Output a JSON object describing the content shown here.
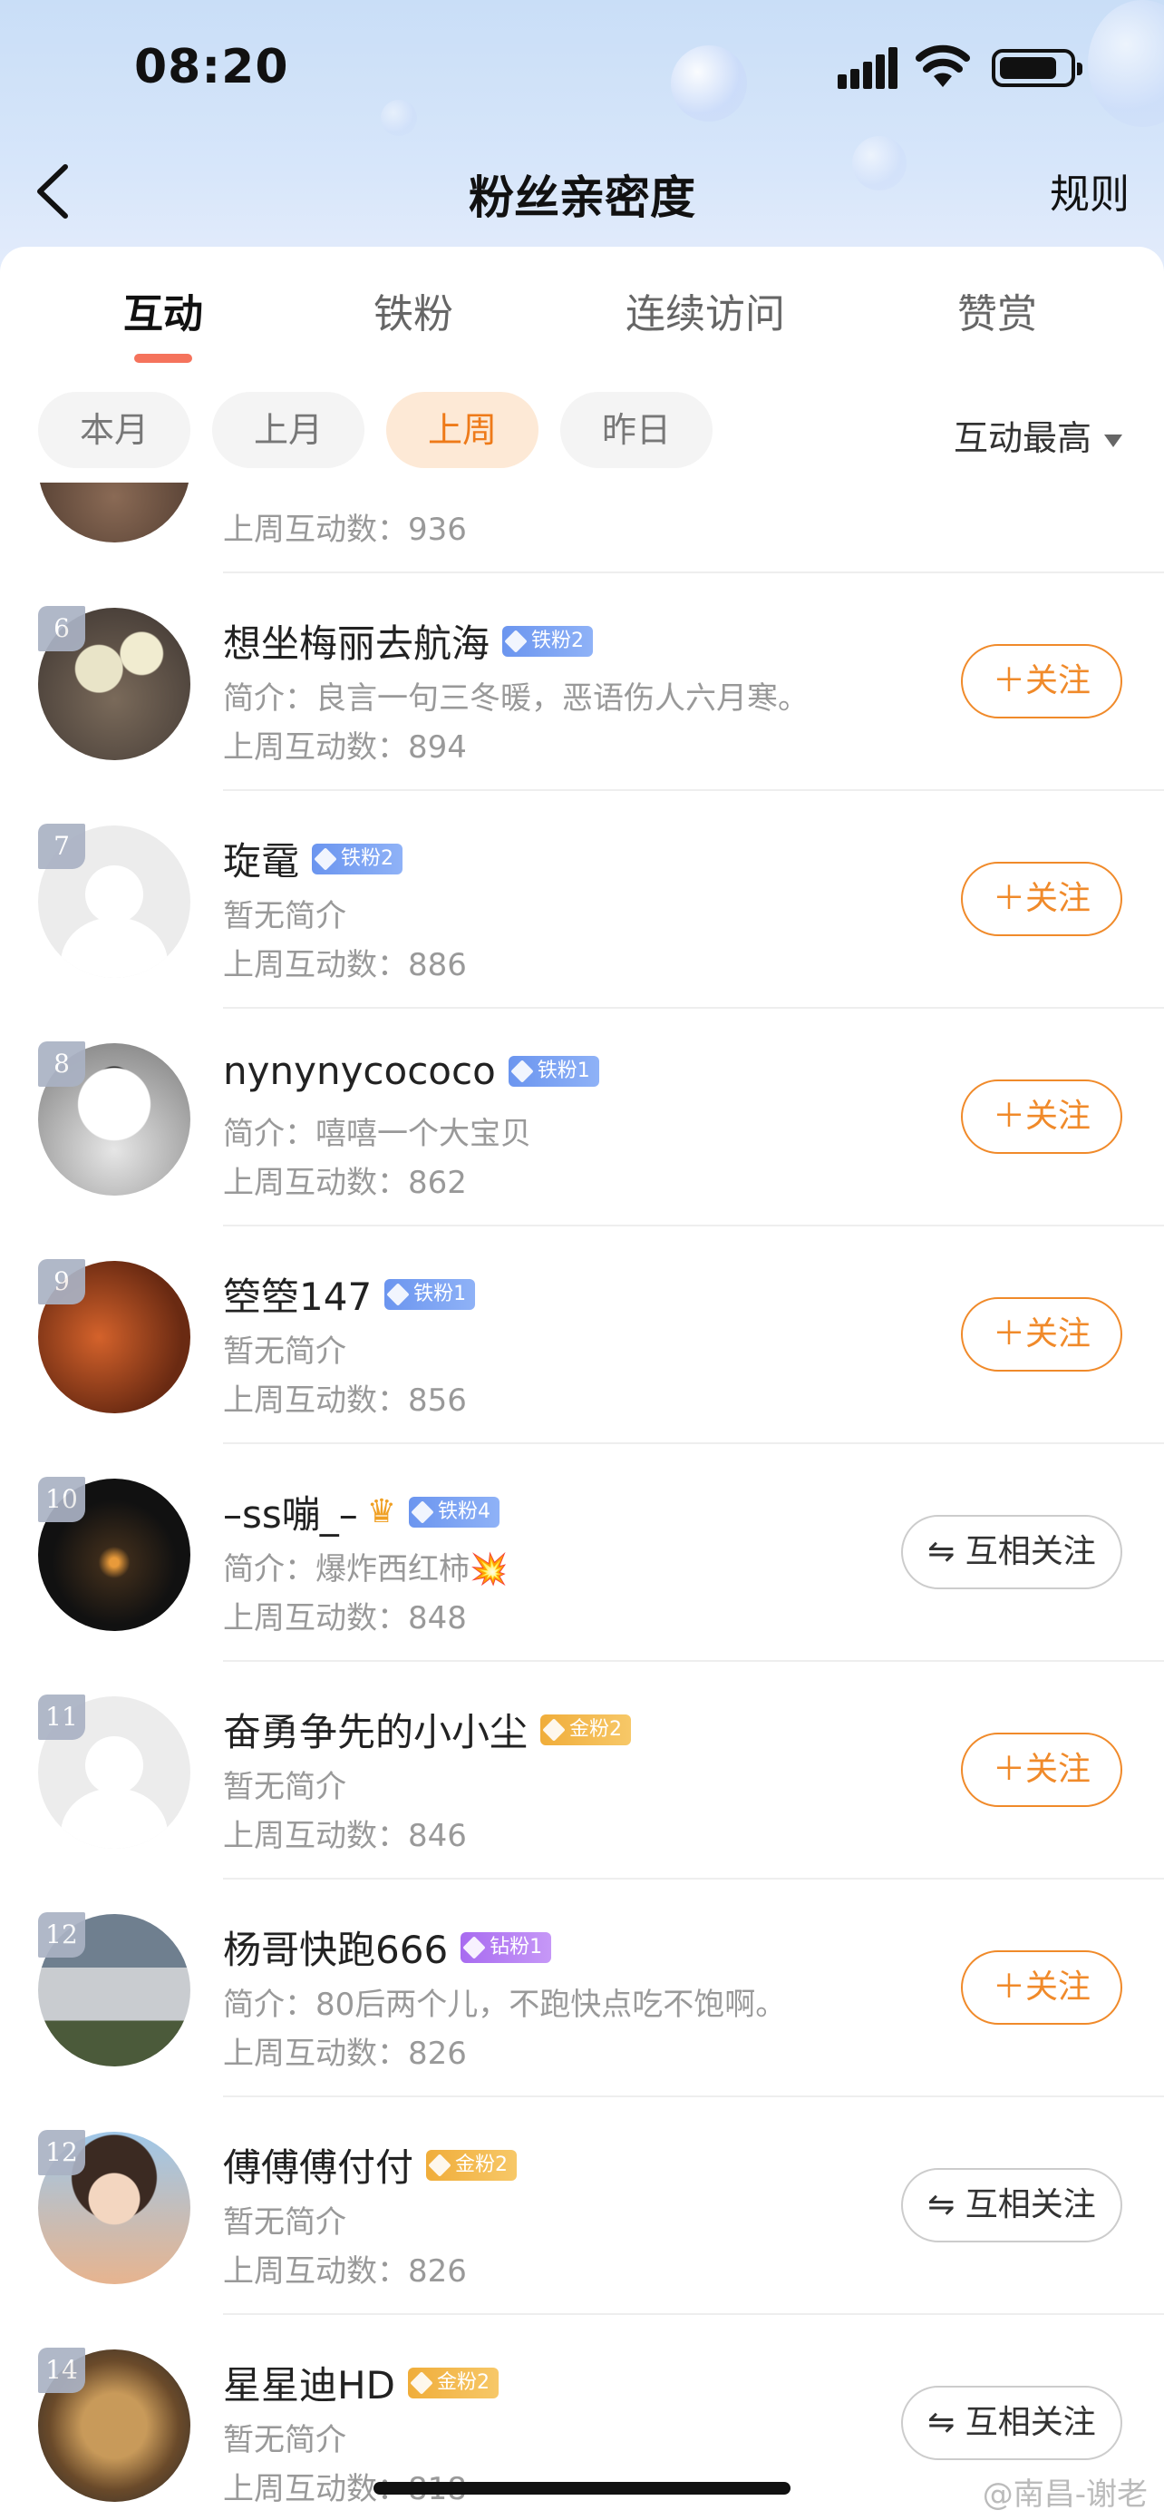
{
  "status_bar": {
    "time": "08:20"
  },
  "nav": {
    "title": "粉丝亲密度",
    "rules": "规则"
  },
  "tabs": [
    {
      "label": "互动",
      "active": true
    },
    {
      "label": "铁粉",
      "active": false
    },
    {
      "label": "连续访问",
      "active": false
    },
    {
      "label": "赞赏",
      "active": false
    }
  ],
  "filters": [
    {
      "label": "本月",
      "selected": false
    },
    {
      "label": "上月",
      "selected": false
    },
    {
      "label": "上周",
      "selected": true
    },
    {
      "label": "昨日",
      "selected": false
    }
  ],
  "sort": {
    "label": "互动最高"
  },
  "partial_row": {
    "count": "上周互动数：936"
  },
  "rows": [
    {
      "rank": "6",
      "name": "想坐梅丽去航海",
      "badge": "铁粉2",
      "badge_type": "blue",
      "crown": false,
      "intro": "简介：良言一句三冬暖，恶语伤人六月寒。",
      "count": "上周互动数：894",
      "button": "＋关注",
      "button_type": "follow",
      "avatar": "drinks-photo"
    },
    {
      "rank": "7",
      "name": "琁鼋",
      "badge": "铁粉2",
      "badge_type": "blue",
      "crown": false,
      "intro": "暂无简介",
      "count": "上周互动数：886",
      "button": "＋关注",
      "button_type": "follow",
      "avatar": "default"
    },
    {
      "rank": "8",
      "name": "nynynycococo",
      "badge": "铁粉1",
      "badge_type": "blue",
      "crown": false,
      "intro": "简介：嘻嘻一个大宝贝",
      "count": "上周互动数：862",
      "button": "＋关注",
      "button_type": "follow",
      "avatar": "dog-plush"
    },
    {
      "rank": "9",
      "name": "箜箜147",
      "badge": "铁粉1",
      "badge_type": "blue",
      "crown": false,
      "intro": "暂无简介",
      "count": "上周互动数：856",
      "button": "＋关注",
      "button_type": "follow",
      "avatar": "autumn-leaves"
    },
    {
      "rank": "10",
      "name": "–ss嘣_–",
      "badge": "铁粉4",
      "badge_type": "blue",
      "crown": true,
      "intro": "简介：爆炸西红柿💥",
      "count": "上周互动数：848",
      "button": "⇋ 互相关注",
      "button_type": "mutual",
      "avatar": "sunset"
    },
    {
      "rank": "11",
      "name": "奋勇争先的小小尘",
      "badge": "金粉2",
      "badge_type": "gold",
      "crown": false,
      "intro": "暂无简介",
      "count": "上周互动数：846",
      "button": "＋关注",
      "button_type": "follow",
      "avatar": "default"
    },
    {
      "rank": "12",
      "name": "杨哥快跑666",
      "badge": "钻粉1",
      "badge_type": "purple",
      "crown": false,
      "intro": "简介：80后两个儿，不跑快点吃不饱啊。",
      "count": "上周互动数：826",
      "button": "＋关注",
      "button_type": "follow",
      "avatar": "van"
    },
    {
      "rank": "12",
      "name": "傅傅傅付付",
      "badge": "金粉2",
      "badge_type": "gold",
      "crown": false,
      "intro": "暂无简介",
      "count": "上周互动数：826",
      "button": "⇋ 互相关注",
      "button_type": "mutual",
      "avatar": "anime-boy"
    },
    {
      "rank": "14",
      "name": "星星迪HD",
      "badge": "金粉2",
      "badge_type": "gold",
      "crown": false,
      "intro": "暂无简介",
      "count": "上周互动数：818",
      "button": "⇋ 互相关注",
      "button_type": "mutual",
      "avatar": "lion"
    }
  ],
  "watermark": "@南昌-谢老",
  "colors": {
    "accent": "#f08a2a",
    "tab_indicator": "#f5735c",
    "selected_chip_bg": "#fde9d6"
  }
}
